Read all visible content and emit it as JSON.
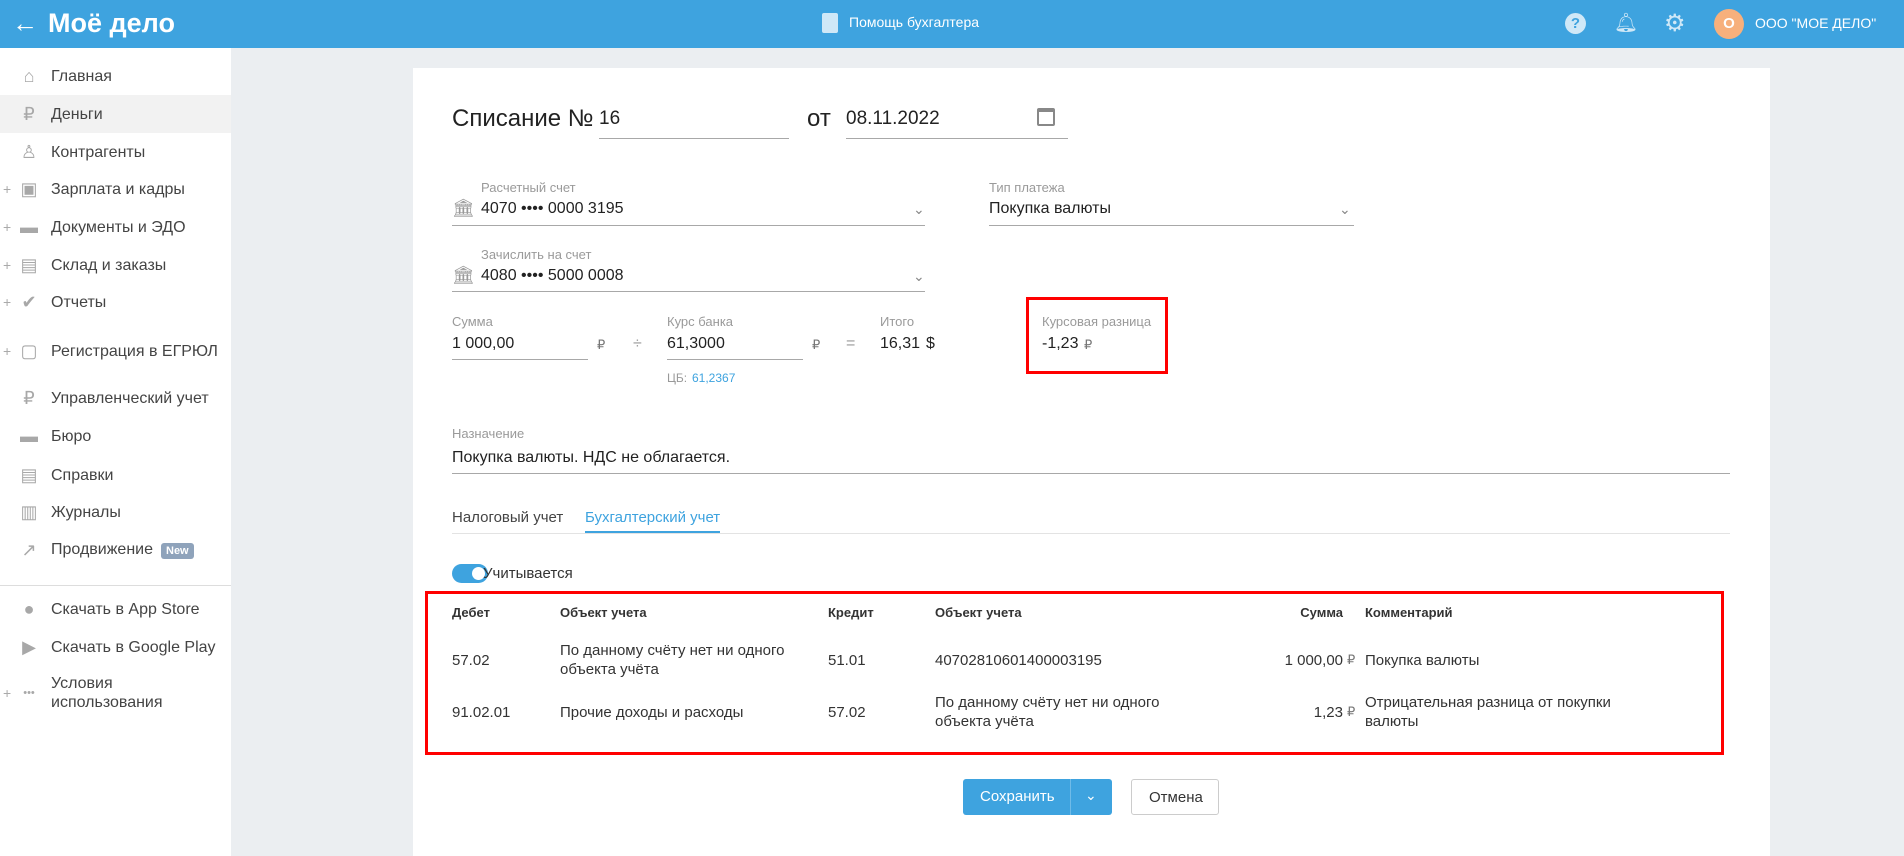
{
  "header": {
    "back_icon": "arrow-left-icon",
    "logo": "Моё дело",
    "help_link": "Помощь бухгалтера",
    "avatar_letter": "О",
    "company": "ООО \"МОЕ ДЕЛО\"",
    "accent": "#3ea3df"
  },
  "sidebar": {
    "items": [
      {
        "label": "Главная",
        "icon": "home-icon",
        "plus": false
      },
      {
        "label": "Деньги",
        "icon": "money-icon",
        "plus": false,
        "active": true
      },
      {
        "label": "Контрагенты",
        "icon": "contractor-icon",
        "plus": false
      },
      {
        "label": "Зарплата и кадры",
        "icon": "wallet-icon",
        "plus": true
      },
      {
        "label": "Документы и ЭДО",
        "icon": "folder-icon",
        "plus": true
      },
      {
        "label": "Склад и заказы",
        "icon": "warehouse-icon",
        "plus": true
      },
      {
        "label": "Отчеты",
        "icon": "report-icon",
        "plus": true
      },
      {
        "label": "Регистрация в ЕГРЮЛ",
        "icon": "registration-icon",
        "plus": true
      },
      {
        "label": "Управленческий учет",
        "icon": "management-icon",
        "plus": false
      },
      {
        "label": "Бюро",
        "icon": "briefcase-icon",
        "plus": false
      },
      {
        "label": "Справки",
        "icon": "reference-icon",
        "plus": false
      },
      {
        "label": "Журналы",
        "icon": "journal-icon",
        "plus": false
      },
      {
        "label": "Продвижение",
        "icon": "chart-icon",
        "plus": false,
        "badge": "New"
      }
    ],
    "bottom": [
      {
        "label": "Скачать в App Store",
        "icon": "apple-icon"
      },
      {
        "label": "Скачать в Google Play",
        "icon": "google-play-icon"
      },
      {
        "label": "Условия использования",
        "icon": "more-icon",
        "plus": true
      }
    ]
  },
  "form": {
    "title": "Списание №",
    "number": "16",
    "date_prefix": "от",
    "date": "08.11.2022",
    "account_label": "Расчетный счет",
    "account": "4070 •••• 0000 3195",
    "payment_type_label": "Тип платежа",
    "payment_type": "Покупка валюты",
    "to_account_label": "Зачислить на счет",
    "to_account": "4080 •••• 5000 0008",
    "sum_label": "Сумма",
    "sum": "1 000,00",
    "currency_rub": "₽",
    "divide": "÷",
    "rate_label": "Курс банка",
    "rate": "61,3000",
    "equals": "=",
    "total_label": "Итого",
    "total": "16,31",
    "currency_usd": "$",
    "cb_label": "ЦБ:",
    "cb_rate": "61,2367",
    "diff_label": "Курсовая разница",
    "diff": "-1,23",
    "purpose_label": "Назначение",
    "purpose": "Покупка валюты. НДС не облагается.",
    "tabs": [
      "Налоговый учет",
      "Бухгалтерский учет"
    ],
    "toggle_label": "Учитывается",
    "toggle_on": true,
    "table": {
      "headers": [
        "Дебет",
        "Объект учета",
        "Кредит",
        "Объект учета",
        "Сумма",
        "Комментарий"
      ],
      "rows": [
        [
          "57.02",
          "По данному счёту нет ни одного объекта учёта",
          "51.01",
          "40702810601400003195",
          "1 000,00",
          "Покупка валюты"
        ],
        [
          "91.02.01",
          "Прочие доходы и расходы",
          "57.02",
          "По данному счёту нет ни одного объекта учёта",
          "1,23",
          "Отрицательная разница от покупки валюты"
        ]
      ]
    },
    "save": "Сохранить",
    "cancel": "Отмена"
  }
}
